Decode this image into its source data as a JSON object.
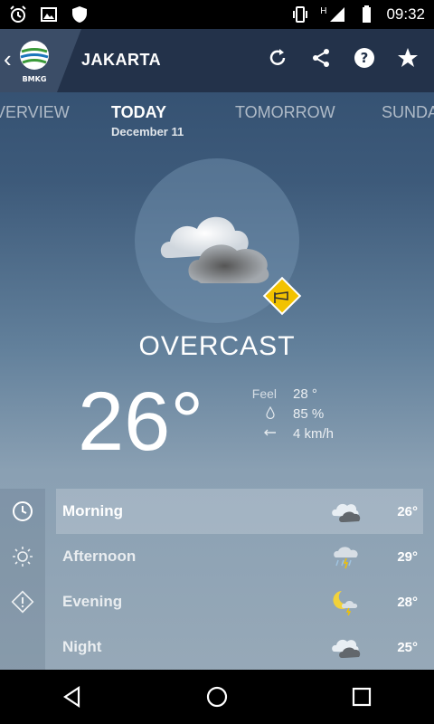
{
  "status_bar": {
    "time": "09:32",
    "network_label": "H"
  },
  "app_bar": {
    "logo_text": "BMKG",
    "city": "JAKARTA"
  },
  "tabs": [
    {
      "label": "VERVIEW",
      "sub": ""
    },
    {
      "label": "TODAY",
      "sub": "December 11",
      "active": true
    },
    {
      "label": "TOMORROW",
      "sub": ""
    },
    {
      "label": "SUNDA",
      "sub": ""
    }
  ],
  "current": {
    "condition": "OVERCAST",
    "temperature": "26°",
    "feel_label": "Feel",
    "feel_value": "28 °",
    "humidity_value": "85 %",
    "wind_value": "4 km/h"
  },
  "periods": [
    {
      "label": "Morning",
      "temp": "26°",
      "icon": "cloud-overcast-icon",
      "active": true
    },
    {
      "label": "Afternoon",
      "temp": "29°",
      "icon": "cloud-rain-thunder-icon"
    },
    {
      "label": "Evening",
      "temp": "28°",
      "icon": "moon-cloud-thunder-icon"
    },
    {
      "label": "Night",
      "temp": "25°",
      "icon": "cloud-overcast-icon"
    }
  ],
  "colors": {
    "app_bar": "#23324a",
    "warning": "#f2c200"
  }
}
